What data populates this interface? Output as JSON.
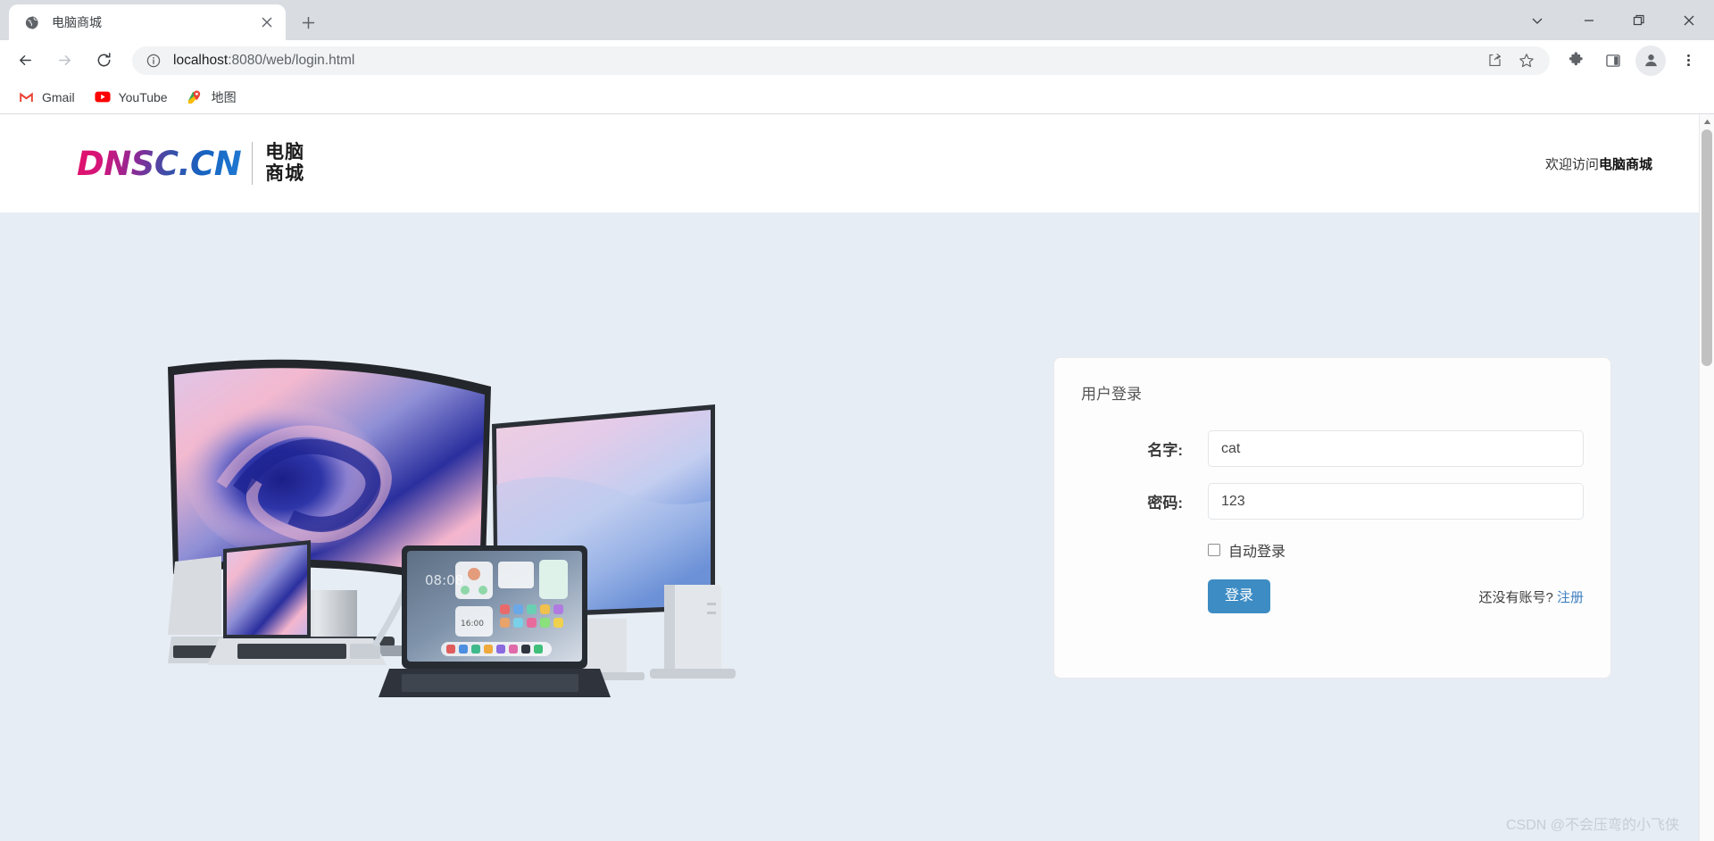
{
  "browser": {
    "tab": {
      "title": "电脑商城",
      "favicon": "globe-icon",
      "close": "×"
    },
    "new_tab": "+",
    "window_controls": {
      "tab_search": "chevron-down-icon",
      "minimize": "minimize-icon",
      "maximize": "restore-icon",
      "close": "close-icon"
    },
    "nav": {
      "back": "back-arrow-icon",
      "forward": "forward-arrow-icon",
      "reload": "reload-icon"
    },
    "omnibox": {
      "info_icon": "site-info-icon",
      "url_host": "localhost",
      "url_path": ":8080/web/login.html",
      "share_icon": "share-icon",
      "bookmark_icon": "star-icon"
    },
    "toolbar_icons": {
      "extensions": "puzzle-icon",
      "side_panel": "side-panel-icon",
      "profile": "avatar-icon",
      "menu": "three-dot-menu-icon"
    },
    "bookmarks": [
      {
        "label": "Gmail",
        "icon": "gmail-icon"
      },
      {
        "label": "YouTube",
        "icon": "youtube-icon"
      },
      {
        "label": "地图",
        "icon": "google-maps-icon"
      }
    ]
  },
  "site": {
    "logo_word": "DNSC.CN",
    "logo_cn_line1": "电脑",
    "logo_cn_line2": "商城",
    "welcome_prefix": "欢迎访问",
    "welcome_brand": "电脑商城"
  },
  "login": {
    "title": "用户登录",
    "fields": [
      {
        "label": "名字:",
        "value": "cat",
        "placeholder": "",
        "name": "username"
      },
      {
        "label": "密码:",
        "value": "123",
        "placeholder": "",
        "name": "password"
      }
    ],
    "auto_login_label": "自动登录",
    "auto_login_checked": false,
    "submit_label": "登录",
    "register_prompt": "还没有账号?",
    "register_link": "注册",
    "accent_color": "#3d8cc4",
    "link_color": "#3f7fc1"
  },
  "hero": {
    "alt": "computer-products-illustration",
    "background_color": "#e7edf5"
  },
  "watermark": "CSDN @不会压弯的小飞侠",
  "scrollbar": {
    "up_arrow": "▲"
  }
}
